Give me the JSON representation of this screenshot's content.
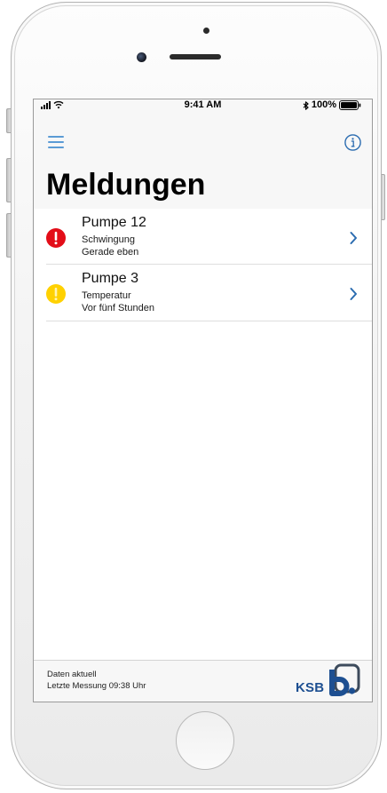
{
  "status_bar": {
    "time": "9:41 AM",
    "battery": "100%",
    "icons": [
      "signal-icon",
      "wifi-icon",
      "bluetooth-icon",
      "battery-icon"
    ]
  },
  "nav": {
    "menu_icon": "hamburger-menu-icon",
    "info_icon": "info-icon",
    "title": "Meldungen"
  },
  "alerts": [
    {
      "title": "Pumpe 12",
      "type": "Schwingung",
      "time": "Gerade eben",
      "icon": "exclamation-circle-icon",
      "icon_color": "#e30d18"
    },
    {
      "title": "Pumpe 3",
      "type": "Temperatur",
      "time": "Vor fünf Stunden",
      "icon": "exclamation-circle-icon",
      "icon_color": "#ffd100"
    }
  ],
  "footer": {
    "status": "Daten aktuell",
    "last_measurement": "Letzte Messung 09:38 Uhr",
    "logo_text": "KSB"
  },
  "colors": {
    "accent": "#2b6cb0",
    "menu_icon": "#5b9bd5",
    "header_bg": "#f7f7f7",
    "logo_blue": "#1d4f91"
  }
}
